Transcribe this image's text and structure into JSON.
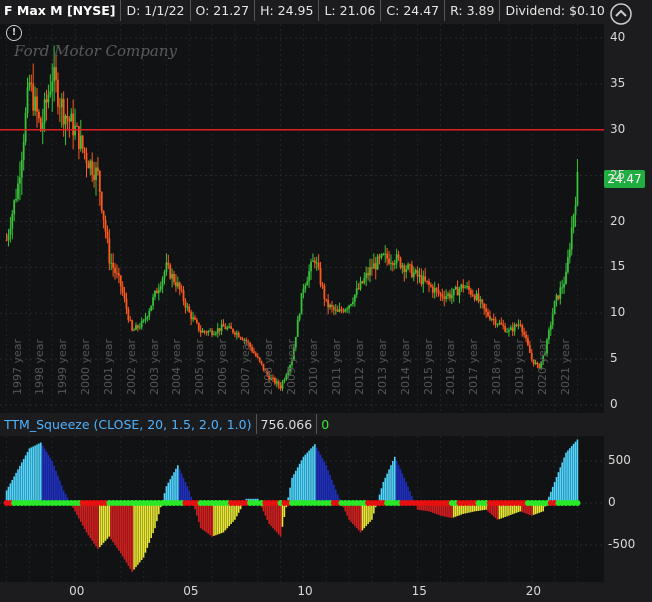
{
  "header": {
    "symbol": "F Max M [NYSE]",
    "date": "D: 1/1/22",
    "open": "O: 21.27",
    "high": "H: 24.95",
    "low": "L: 21.06",
    "close": "C: 24.47",
    "range": "R: 3.89",
    "dividend": "Dividend: $0.10"
  },
  "price_panel": {
    "watermark": "Ford Motor Company",
    "last_price_badge": "24.47",
    "y_ticks": [
      "40",
      "35",
      "30",
      "25",
      "20",
      "15",
      "10",
      "5",
      "0"
    ],
    "year_labels": [
      "1997 year",
      "1998 year",
      "1999 year",
      "2000 year",
      "2001 year",
      "2002 year",
      "2003 year",
      "2004 year",
      "2005 year",
      "2006 year",
      "2007 year",
      "2008 year",
      "2009 year",
      "2010 year",
      "2011 year",
      "2012 year",
      "2013 year",
      "2014 year",
      "2015 year",
      "2016 year",
      "2017 year",
      "2018 year",
      "2019 year",
      "2020 year",
      "2021 year"
    ],
    "colors": {
      "up": "#38c23a",
      "down": "#ff5a1e",
      "hline": "#e02020"
    }
  },
  "indicator": {
    "name": "TTM_Squeeze (CLOSE, 20, 1.5, 2.0, 1.0)",
    "value": "756.066",
    "value2": "0",
    "y_ticks": [
      "500",
      "0",
      "-500"
    ],
    "x_ticks": [
      "00",
      "05",
      "10",
      "15",
      "20"
    ]
  },
  "chart_data": [
    {
      "type": "line",
      "title": "",
      "xlabel": "",
      "ylabel": "",
      "ylim": [
        0,
        42
      ],
      "hline": 30,
      "last": 24.47,
      "series": [
        {
          "x": [
            1997,
            1997.5,
            1998,
            1998.5,
            1999,
            1999.5,
            2000,
            2000.5,
            2001,
            2001.5,
            2002,
            2002.5,
            2003,
            2003.5,
            2004,
            2004.5,
            2005,
            2005.5,
            2006,
            2006.5,
            2007,
            2007.5,
            2008,
            2008.5,
            2009,
            2009.5,
            2010,
            2010.5,
            2011,
            2011.5,
            2012,
            2012.5,
            2013,
            2013.5,
            2014,
            2014.5,
            2015,
            2015.5,
            2016,
            2016.5,
            2017,
            2017.5,
            2018,
            2018.5,
            2019,
            2019.5,
            2020,
            2020.3,
            2020.6,
            2021,
            2021.5,
            2022
          ],
          "values": [
            18,
            24,
            35,
            30,
            36,
            32,
            30,
            27,
            25,
            16,
            13,
            8,
            9,
            12,
            15,
            13,
            10,
            8,
            8,
            8.5,
            8,
            7,
            5,
            3,
            2,
            5,
            13,
            16,
            11,
            10,
            11,
            13,
            15,
            16,
            16,
            15,
            14,
            13,
            12,
            12,
            13,
            12,
            10,
            9,
            8,
            9,
            5,
            4,
            6,
            11,
            14,
            24.5
          ]
        }
      ]
    },
    {
      "type": "bar",
      "title": "",
      "ylim": [
        -800,
        800
      ],
      "x_years": [
        1997,
        1997.5,
        1998,
        1998.5,
        1999,
        1999.5,
        2000,
        2000.5,
        2001,
        2001.5,
        2002,
        2002.5,
        2003,
        2003.5,
        2004,
        2004.5,
        2005,
        2005.5,
        2006,
        2006.5,
        2007,
        2007.5,
        2008,
        2008.5,
        2009,
        2009.5,
        2010,
        2010.5,
        2011,
        2011.5,
        2012,
        2012.5,
        2013,
        2013.5,
        2014,
        2014.5,
        2015,
        2015.5,
        2016,
        2016.5,
        2017,
        2017.5,
        2018,
        2018.5,
        2019,
        2019.5,
        2020,
        2020.5,
        2021,
        2021.5,
        2022
      ],
      "values": [
        150,
        400,
        650,
        720,
        500,
        150,
        -100,
        -350,
        -550,
        -400,
        -600,
        -820,
        -650,
        -300,
        200,
        450,
        150,
        -300,
        -400,
        -350,
        -200,
        50,
        50,
        -250,
        -400,
        300,
        550,
        700,
        450,
        100,
        -200,
        -350,
        -200,
        250,
        550,
        250,
        -80,
        -100,
        -150,
        -180,
        -130,
        -100,
        -80,
        -200,
        -150,
        -100,
        -150,
        -100,
        250,
        600,
        756
      ]
    }
  ]
}
